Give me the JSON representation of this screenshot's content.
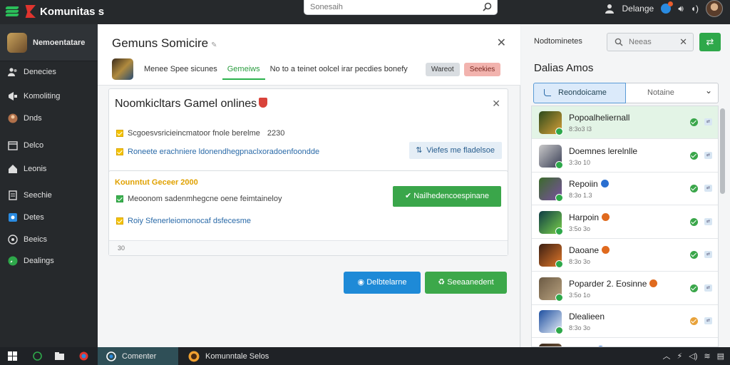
{
  "app": {
    "title": "Komunitas",
    "title_suffix": "s"
  },
  "search": {
    "placeholder": "Sonesaih"
  },
  "topbar": {
    "user_label": "Delange"
  },
  "sidebar": {
    "header": "Nemoentatare",
    "items": [
      {
        "label": "Denecies",
        "icon": "people-icon"
      },
      {
        "label": "Komoliting",
        "icon": "megaphone-icon"
      },
      {
        "label": "Dnds",
        "icon": "avatar-icon"
      },
      {
        "label": "Delco",
        "icon": "calendar-icon"
      },
      {
        "label": "Leonis",
        "icon": "home-icon"
      },
      {
        "label": "Seechie",
        "icon": "document-icon"
      },
      {
        "label": "Detes",
        "icon": "image-icon"
      },
      {
        "label": "Beeics",
        "icon": "clock-icon"
      },
      {
        "label": "Dealings",
        "icon": "chat-icon"
      }
    ]
  },
  "main": {
    "title": "Gemuns Somicire",
    "tabs": [
      {
        "label": "Menee Spee sicunes"
      },
      {
        "label": "Gemeiws",
        "active": true
      },
      {
        "label": "No to a teinet oolcel irar pecdies bonefy"
      }
    ],
    "btn_gray": "Wareot",
    "btn_red": "Seekies",
    "card1": {
      "title": "Noomkicltars Gamel onlines",
      "items": [
        {
          "text": "Scgoesvsricieincmatoor fnole berelme",
          "value": "2230",
          "color": "#444"
        },
        {
          "text": "Roneete erachniere ldonendhegpnaclxoradoenfoondde",
          "value": "",
          "color": "#2a6aa8"
        }
      ],
      "button": "Viefes me fladelsoe"
    },
    "card2": {
      "title": "Kounntut Geceer",
      "title_value": "2000",
      "items": [
        {
          "text": "Meoonom sadenmhegcne oene feimtaineloy",
          "color": "#444"
        },
        {
          "text": "Roiy Sfenerleiomonocaf dsfecesme",
          "color": "#2a6aa8"
        }
      ],
      "button": "Nailhedencoespinane",
      "footer": "30"
    },
    "actions": {
      "blue": "Delbtelarne",
      "green": "Seeaanedent"
    }
  },
  "right": {
    "title": "Nodtominetes",
    "search_placeholder": "Neeas",
    "subtitle": "Dalias Amos",
    "seg_active": "Reondoicame",
    "seg_select": "Notaine",
    "games": [
      {
        "name": "Popoalheliernall",
        "sub": "8:3o3 l3",
        "badge": "",
        "status": "#3aa64a",
        "selected": true,
        "c1": "#2c4a1c",
        "c2": "#d8a037"
      },
      {
        "name": "Doemnes lerelnlle",
        "sub": "3:3o 10",
        "badge": "",
        "status": "#3aa64a",
        "selected": false,
        "c1": "#c9c9c9",
        "c2": "#3a3f56"
      },
      {
        "name": "Repoiin",
        "sub": "8:3o 1.3",
        "badge": "#2a6fd0",
        "status": "#3aa64a",
        "selected": false,
        "c1": "#3b6b2c",
        "c2": "#7a4fa0"
      },
      {
        "name": "Harpoin",
        "sub": "3:5o 3o",
        "badge": "#e06a1e",
        "status": "#3aa64a",
        "selected": false,
        "c1": "#0e3c44",
        "c2": "#7ad04a"
      },
      {
        "name": "Daoane",
        "sub": "8:3o 3o",
        "badge": "#e06a1e",
        "status": "#3aa64a",
        "selected": false,
        "c1": "#3b1e12",
        "c2": "#e0782a"
      },
      {
        "name": "Poparder 2. Eosinne",
        "sub": "3:5o 1o",
        "badge": "#e06a1e",
        "status": "#3aa64a",
        "selected": false,
        "c1": "#6b5a44",
        "c2": "#b9a27f"
      },
      {
        "name": "Dlealieen",
        "sub": "8:3o 3o",
        "badge": "",
        "status": "#e8a23a",
        "selected": false,
        "c1": "#1e4fa0",
        "c2": "#e7eef7"
      },
      {
        "name": "Decrin",
        "sub": "",
        "badge": "#2a6fd0",
        "status": "#3aa64a",
        "selected": false,
        "c1": "#3a2a1c",
        "c2": "#8a6a4a"
      }
    ]
  },
  "taskbar": {
    "app1": "Comenter",
    "app2": "Komunntale Selos"
  },
  "colors": {
    "accent_green": "#2ea84a",
    "accent_blue": "#1e8ad7",
    "dark": "#26292c"
  }
}
